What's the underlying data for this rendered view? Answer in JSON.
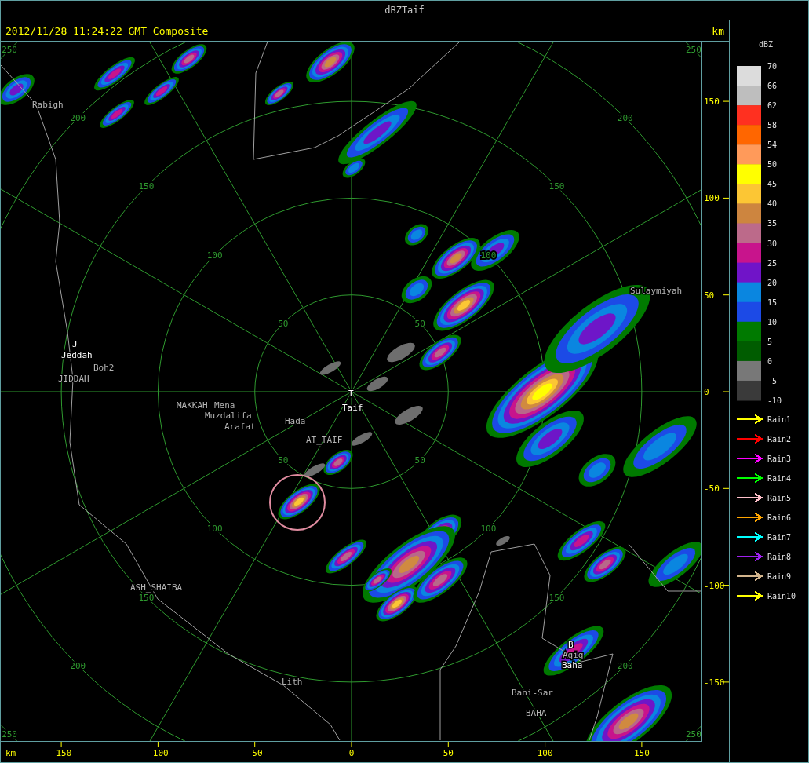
{
  "window": {
    "title": "dBZTaif"
  },
  "header": {
    "timestamp": "2012/11/28 11:24:22 GMT Composite",
    "unit": "km"
  },
  "map": {
    "range_rings": [
      {
        "labels": [
          "50",
          "50",
          "50",
          "50"
        ]
      },
      {
        "labels": [
          "100",
          "100",
          "100",
          "100"
        ]
      },
      {
        "labels": [
          "150",
          "150",
          "150",
          "150"
        ]
      },
      {
        "labels": [
          "200",
          "200",
          "200",
          "200"
        ]
      },
      {
        "labels": [
          "250",
          "250",
          "250",
          "250"
        ]
      }
    ],
    "places": [
      {
        "label": "Rabigh",
        "kind": "secondary"
      },
      {
        "label": "J",
        "kind": "primary"
      },
      {
        "label": "Jeddah",
        "kind": "primary"
      },
      {
        "label": "Boh2",
        "kind": "secondary"
      },
      {
        "label": "JIDDAH",
        "kind": "secondary"
      },
      {
        "label": "MAKKAH",
        "kind": "secondary"
      },
      {
        "label": "Mena",
        "kind": "secondary"
      },
      {
        "label": "Muzdalifa",
        "kind": "secondary"
      },
      {
        "label": "Arafat",
        "kind": "secondary"
      },
      {
        "label": "Hada",
        "kind": "secondary"
      },
      {
        "label": "T",
        "kind": "primary"
      },
      {
        "label": "Taif",
        "kind": "primary"
      },
      {
        "label": "AT_TAIF",
        "kind": "secondary"
      },
      {
        "label": "Sulaymiyah",
        "kind": "secondary"
      },
      {
        "label": "ASH_SHAIBA",
        "kind": "secondary"
      },
      {
        "label": "Lith",
        "kind": "secondary"
      },
      {
        "label": "B",
        "kind": "primary"
      },
      {
        "label": "Aqiq",
        "kind": "secondary"
      },
      {
        "label": "Baha",
        "kind": "primary"
      },
      {
        "label": "Bani-Sar",
        "kind": "secondary"
      },
      {
        "label": "BAHA",
        "kind": "secondary"
      }
    ]
  },
  "y_axis": {
    "ticks": [
      "150",
      "100",
      "50",
      "0",
      "-50",
      "-100",
      "-150"
    ]
  },
  "x_axis": {
    "unit": "km",
    "ticks": [
      "-150",
      "-100",
      "-50",
      "0",
      "50",
      "100",
      "150"
    ]
  },
  "legend": {
    "title": "dBZ",
    "bands": [
      {
        "color": "#dcdcdc"
      },
      {
        "color": "#bebebe"
      },
      {
        "color": "#ff3020"
      },
      {
        "color": "#ff6600"
      },
      {
        "color": "#ff9a5a"
      },
      {
        "color": "#ffff00"
      },
      {
        "color": "#fcc634"
      },
      {
        "color": "#cd853f"
      },
      {
        "color": "#bc6a8a"
      },
      {
        "color": "#c8148c"
      },
      {
        "color": "#7014c8"
      },
      {
        "color": "#0a86e0"
      },
      {
        "color": "#1c4ae6"
      },
      {
        "color": "#007a00"
      },
      {
        "color": "#005c00"
      },
      {
        "color": "#787878"
      },
      {
        "color": "#3a3a3a"
      }
    ],
    "labels": [
      "70",
      "66",
      "62",
      "58",
      "54",
      "50",
      "45",
      "40",
      "35",
      "30",
      "25",
      "20",
      "15",
      "10",
      "5",
      "0",
      "-5",
      "-10"
    ],
    "tracks": [
      {
        "label": "Rain1",
        "color": "#ffff00"
      },
      {
        "label": "Rain2",
        "color": "#ff0000"
      },
      {
        "label": "Rain3",
        "color": "#ff00ff"
      },
      {
        "label": "Rain4",
        "color": "#00ff00"
      },
      {
        "label": "Rain5",
        "color": "#ffc0cb"
      },
      {
        "label": "Rain6",
        "color": "#ffa500"
      },
      {
        "label": "Rain7",
        "color": "#00ffff"
      },
      {
        "label": "Rain8",
        "color": "#a020f0"
      },
      {
        "label": "Rain9",
        "color": "#d2b48c"
      },
      {
        "label": "Rain10",
        "color": "#ffff00"
      }
    ]
  }
}
